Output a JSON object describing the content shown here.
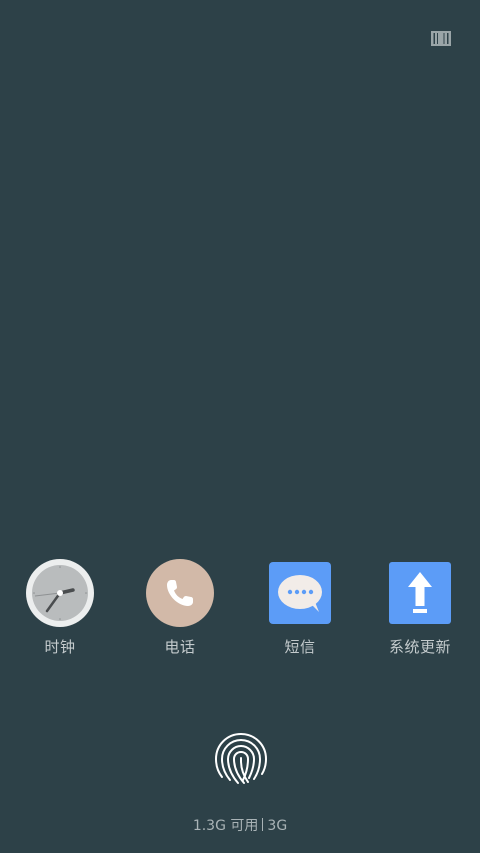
{
  "apps": [
    {
      "label": "时钟",
      "icon": "clock-icon"
    },
    {
      "label": "电话",
      "icon": "phone-icon"
    },
    {
      "label": "短信",
      "icon": "message-icon"
    },
    {
      "label": "系统更新",
      "icon": "system-update-icon"
    }
  ],
  "storage": {
    "available": "1.3G 可用",
    "network": "3G"
  },
  "colors": {
    "background": "#2d4148",
    "phone_bg": "#d2b9a8",
    "message_bg": "#5c9cf7",
    "update_bg": "#5c9cf7"
  }
}
